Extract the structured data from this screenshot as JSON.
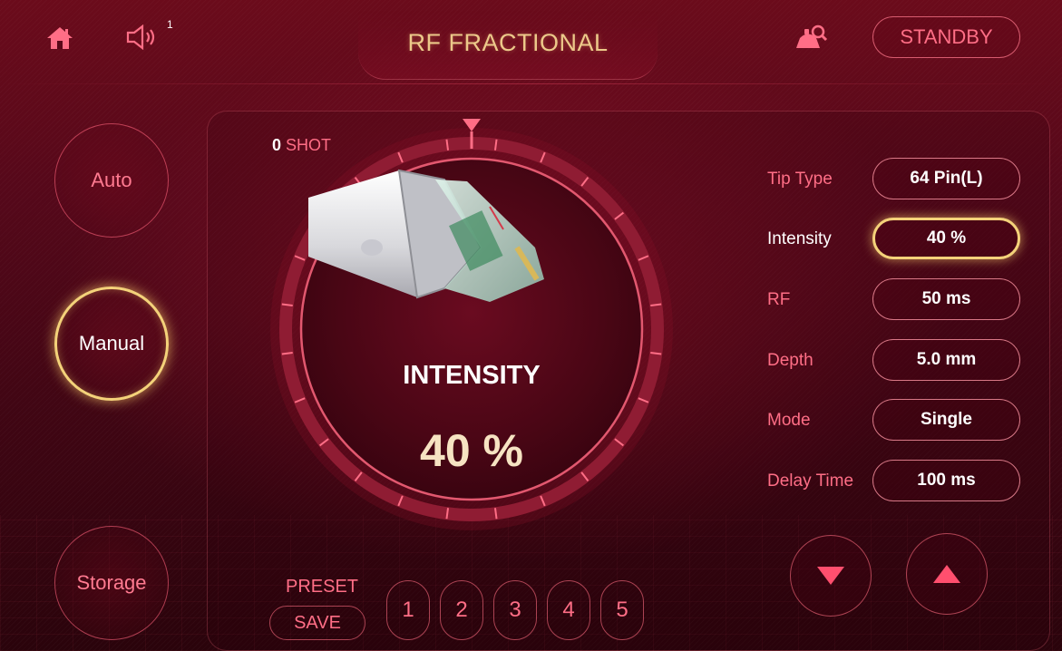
{
  "header": {
    "title": "RF FRACTIONAL",
    "volume_level": "1",
    "status_button": "STANDBY"
  },
  "modes": [
    {
      "label": "Auto",
      "active": false
    },
    {
      "label": "Manual",
      "active": true
    },
    {
      "label": "Storage",
      "active": false
    }
  ],
  "dial": {
    "shot_count": "0",
    "shot_label": "SHOT",
    "label": "INTENSITY",
    "value": "40 %",
    "intensity_fraction": 0.4
  },
  "settings": [
    {
      "label": "Tip Type",
      "value": "64 Pin(L)",
      "active": false
    },
    {
      "label": "Intensity",
      "value": "40 %",
      "active": true
    },
    {
      "label": "RF",
      "value": "50 ms",
      "active": false
    },
    {
      "label": "Depth",
      "value": "5.0 mm",
      "active": false
    },
    {
      "label": "Mode",
      "value": "Single",
      "active": false
    },
    {
      "label": "Delay Time",
      "value": "100 ms",
      "active": false
    }
  ],
  "preset": {
    "title": "PRESET",
    "save_label": "SAVE",
    "slots": [
      "1",
      "2",
      "3",
      "4",
      "5"
    ]
  },
  "colors": {
    "accent_pink": "#ff6e86",
    "gold": "#f4d27a",
    "title_gold": "#ecc98a",
    "background": "#55081a"
  },
  "icons": {
    "home": "home-icon",
    "volume": "volume-icon",
    "operator": "operator-search-icon",
    "down": "triangle-down-icon",
    "up": "triangle-up-icon"
  }
}
